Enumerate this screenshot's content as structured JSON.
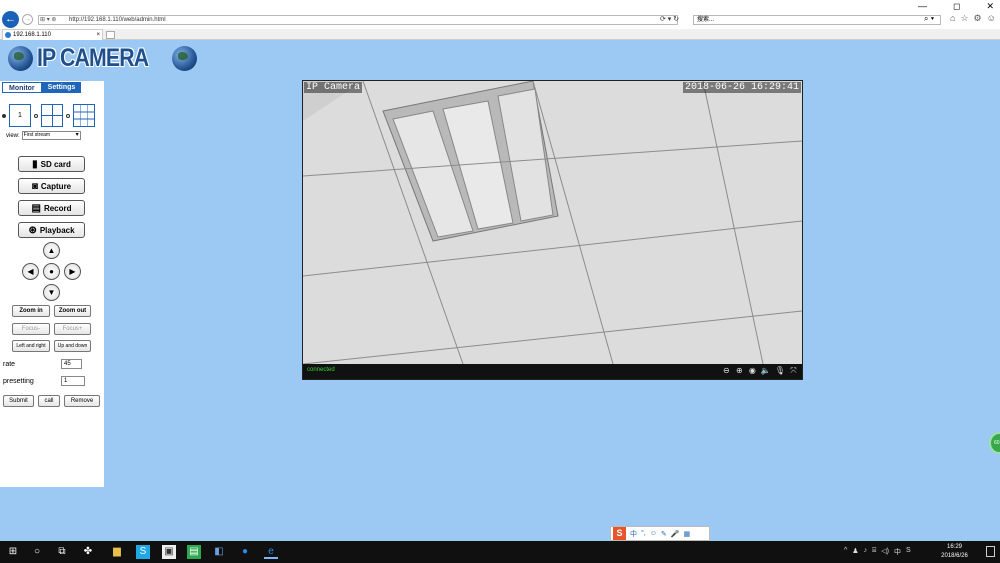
{
  "browser": {
    "url": "http://192.168.1.110/web/admin.html",
    "search_placeholder": "搜索...",
    "tab_title": "192.168.1.110",
    "tab_close": "×",
    "win_controls": [
      "—",
      "◻",
      "✕"
    ],
    "icons": [
      "home-icon",
      "star-icon",
      "gear-icon",
      "smiley-icon"
    ]
  },
  "page": {
    "logo_text": "IP CAMERA",
    "tabs": [
      "Monitor",
      "Settings"
    ],
    "layout_first_label": "1",
    "view_label": "view:",
    "view_value": "First stream",
    "buttons": {
      "sd_card": "SD card",
      "capture": "Capture",
      "record": "Record",
      "playback": "Playback"
    },
    "zoom_in": "Zoom in",
    "zoom_out": "Zoom out",
    "focus_minus": "Focus-",
    "focus_plus": "Focus+",
    "left_right": "Left and right",
    "up_down": "Up and down",
    "rate_label": "rate",
    "rate_value": "45",
    "presetting_label": "presetting",
    "presetting_value": "1",
    "submit": "Submit",
    "call": "call",
    "remove": "Remove"
  },
  "video": {
    "osd_name": "IP Camera",
    "osd_time": "2018-06-26 16:29:41",
    "status": "connected"
  },
  "side_widget": "60",
  "ime": {
    "logo": "S",
    "items": [
      "中",
      "°,",
      "☺",
      "✎",
      "🎤",
      "▦"
    ]
  },
  "taskbar": {
    "time": "16:29",
    "date": "2018/6/26",
    "tray_ime": "中"
  },
  "colors": {
    "page_bg": "#9cc8f4",
    "accent": "#1f65b9",
    "status_green": "#3cd43c"
  }
}
